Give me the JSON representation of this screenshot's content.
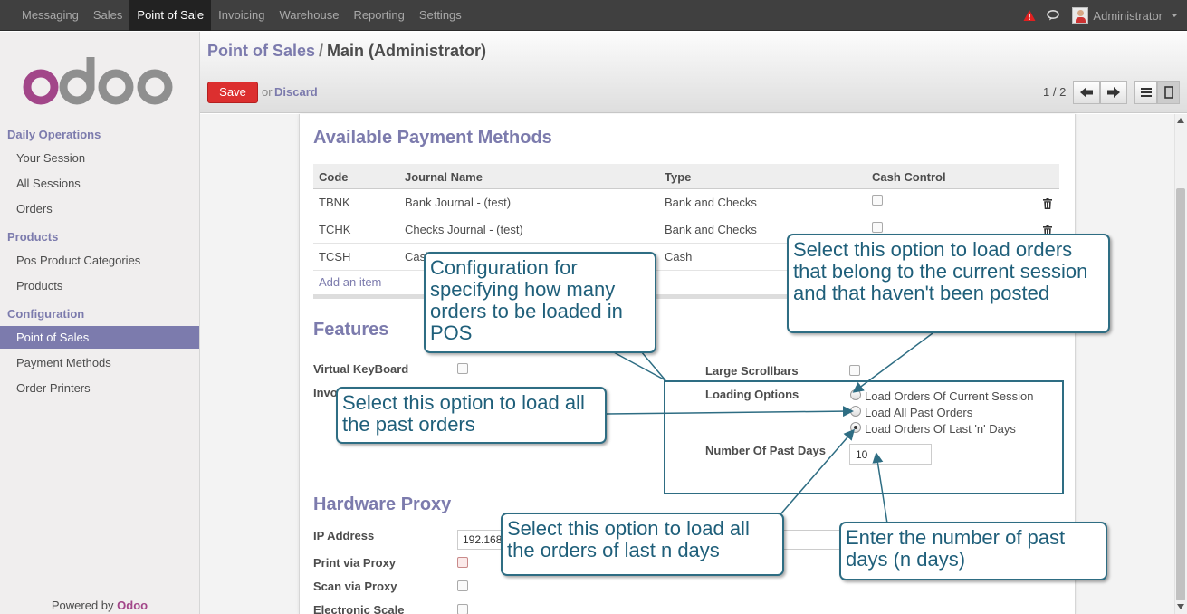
{
  "topnav": {
    "items": [
      "Messaging",
      "Sales",
      "Point of Sale",
      "Invoicing",
      "Warehouse",
      "Reporting",
      "Settings"
    ],
    "active_index": 2,
    "user": "Administrator"
  },
  "sidebar": {
    "logo_text": "odoo",
    "sections": [
      {
        "title": "Daily Operations",
        "items": [
          "Your Session",
          "All Sessions",
          "Orders"
        ]
      },
      {
        "title": "Products",
        "items": [
          "Pos Product Categories",
          "Products"
        ]
      },
      {
        "title": "Configuration",
        "items": [
          "Point of Sales",
          "Payment Methods",
          "Order Printers"
        ]
      }
    ],
    "active_item": "Point of Sales",
    "powered_by": "Powered by",
    "powered_brand": "Odoo"
  },
  "control_panel": {
    "breadcrumb_parent": "Point of Sales",
    "breadcrumb_sep": "/",
    "breadcrumb_current": "Main (Administrator)",
    "save_label": "Save",
    "or_text": "or",
    "discard_label": "Discard",
    "pager": "1 / 2"
  },
  "payment_methods": {
    "title": "Available Payment Methods",
    "columns": [
      "Code",
      "Journal Name",
      "Type",
      "Cash Control"
    ],
    "rows": [
      {
        "code": "TBNK",
        "journal": "Bank Journal - (test)",
        "type": "Bank and Checks"
      },
      {
        "code": "TCHK",
        "journal": "Checks Journal - (test)",
        "type": "Bank and Checks"
      },
      {
        "code": "TCSH",
        "journal": "Cash Journal - (test)",
        "type": "Cash"
      }
    ],
    "add_item": "Add an item"
  },
  "features": {
    "title": "Features",
    "virtual_keyboard": "Virtual KeyBoard",
    "invoicing_partial": "Invo",
    "large_scrollbars": "Large Scrollbars",
    "loading_options_label": "Loading Options",
    "loading_options": [
      "Load Orders Of Current Session",
      "Load All Past Orders",
      "Load Orders Of Last 'n' Days"
    ],
    "selected_option_index": 2,
    "past_days_label": "Number Of Past Days",
    "past_days_value": "10"
  },
  "hardware_proxy": {
    "title": "Hardware Proxy",
    "ip_label": "IP Address",
    "ip_value": "192.168",
    "print_label": "Print via Proxy",
    "scan_label": "Scan via Proxy",
    "scale_label": "Electronic Scale"
  },
  "callouts": {
    "config": "Configuration for specifying how many orders to be loaded in POS",
    "current_session": "Select this option to load orders that belong to the current session and that haven't been posted",
    "all_past": "Select this option to load all the past orders",
    "last_n_days": "Select this option to load all the orders of last n days",
    "num_days": "Enter the number of past days (n days)"
  },
  "colors": {
    "navbar": "#404040",
    "brand": "#7c7bad",
    "save": "#dc2f2f",
    "callout_border": "#2e6d83",
    "callout_text": "#1f5f7a"
  }
}
